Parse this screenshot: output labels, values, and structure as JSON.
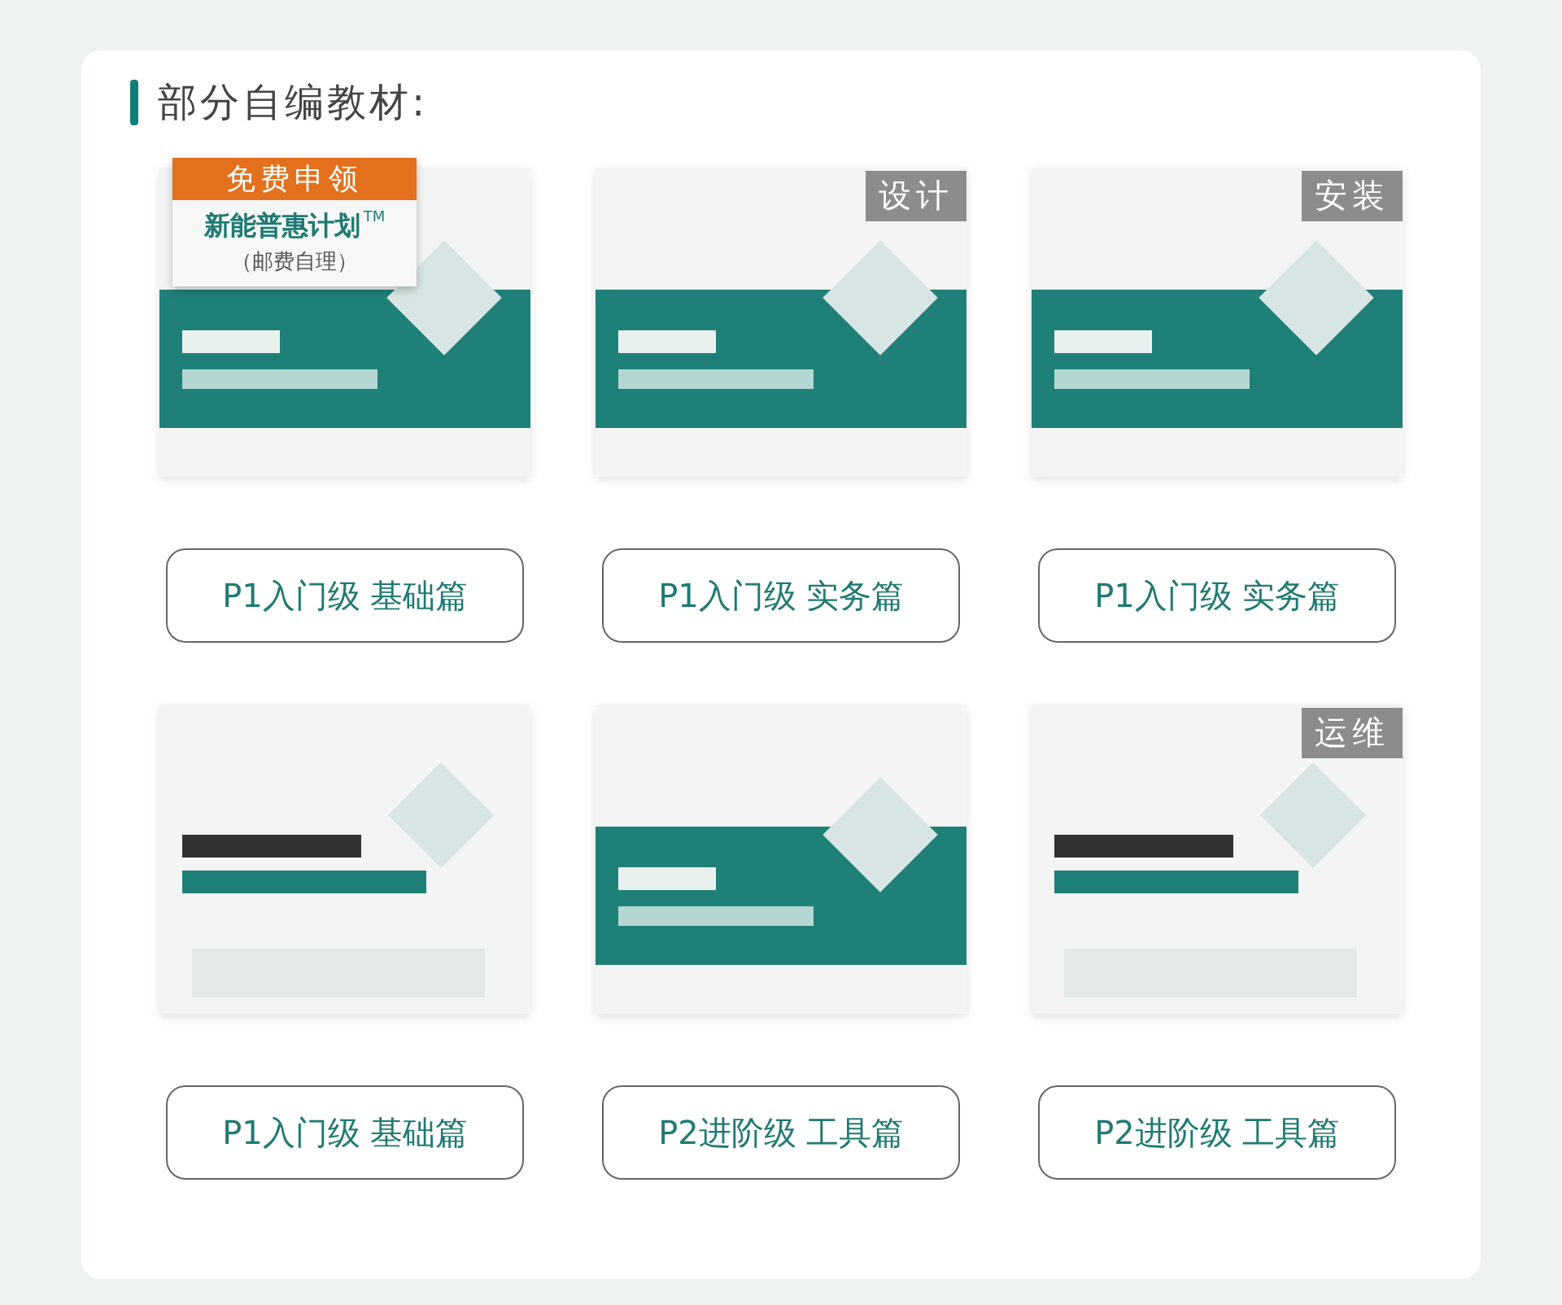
{
  "heading": "部分自编教材:",
  "books": [
    {
      "kind": "teal-band",
      "banner": {
        "ribbon": "免费申领",
        "title": "新能普惠计划",
        "mark": "TM",
        "note": "（邮费自理）"
      },
      "level": "P1入门级",
      "part": "基础篇"
    },
    {
      "kind": "teal-band",
      "tag": "设计",
      "level": "P1入门级",
      "part": "实务篇"
    },
    {
      "kind": "teal-band",
      "tag": "安装",
      "level": "P1入门级",
      "part": "实务篇"
    },
    {
      "kind": "plain",
      "level": "P1入门级",
      "part": "基础篇"
    },
    {
      "kind": "teal-band",
      "level": "P2进阶级",
      "part": "工具篇"
    },
    {
      "kind": "plain",
      "tag": "运维",
      "level": "P2进阶级",
      "part": "工具篇"
    }
  ]
}
